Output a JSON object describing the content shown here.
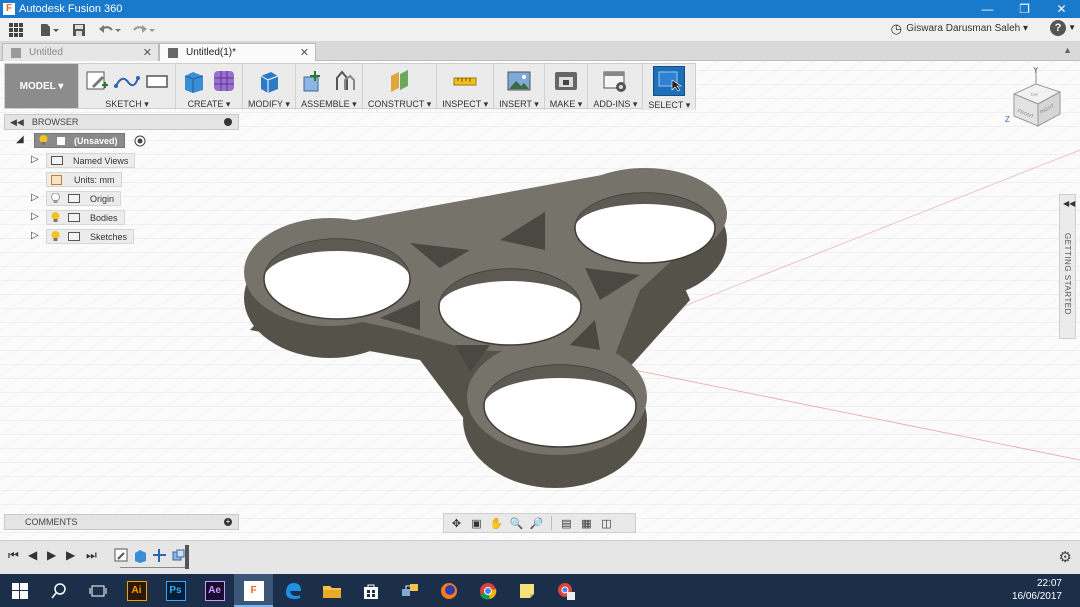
{
  "window": {
    "title": "Autodesk Fusion 360",
    "app_icon": "F",
    "controls": [
      "minimize-icon",
      "restore-icon",
      "close-icon"
    ]
  },
  "quick_access": {
    "user_name": "Giswara Darusman Saleh ▾",
    "help": "?"
  },
  "doc_tabs": [
    {
      "label": "Untitled",
      "active": false
    },
    {
      "label": "Untitled(1)*",
      "active": true
    }
  ],
  "toolbar": {
    "workspace": "MODEL ▾",
    "groups": [
      {
        "label": "SKETCH ▾"
      },
      {
        "label": "CREATE ▾"
      },
      {
        "label": "MODIFY ▾"
      },
      {
        "label": "ASSEMBLE ▾"
      },
      {
        "label": "CONSTRUCT ▾"
      },
      {
        "label": "INSPECT ▾"
      },
      {
        "label": "INSERT ▾"
      },
      {
        "label": "MAKE ▾"
      },
      {
        "label": "ADD-INS ▾"
      },
      {
        "label": "SELECT ▾"
      }
    ]
  },
  "browser": {
    "title": "BROWSER",
    "root": "(Unsaved)",
    "items": [
      {
        "label": "Named Views"
      },
      {
        "label": "Units: mm"
      },
      {
        "label": "Origin"
      },
      {
        "label": "Bodies"
      },
      {
        "label": "Sketches"
      }
    ]
  },
  "viewcube": {
    "axis_z": "Z",
    "axis_y": "Y",
    "face_front": "FRONT",
    "face_right": "RIGHT",
    "face_top": "TOP"
  },
  "getting_started": "GETTING STARTED",
  "comments": "COMMENTS",
  "taskbar": {
    "time": "22:07",
    "date": "16/06/2017",
    "apps": [
      "Ai",
      "Ps",
      "Ae",
      "F"
    ]
  },
  "colors": {
    "titlebar": "#1979ca",
    "model_body": "#6d6a62",
    "taskbar": "#1c2f4a"
  }
}
